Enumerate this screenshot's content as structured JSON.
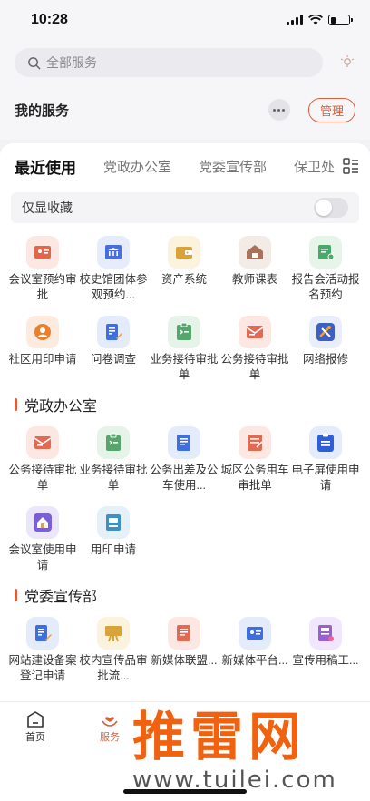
{
  "status": {
    "time": "10:28"
  },
  "search": {
    "placeholder": "全部服务"
  },
  "my_services": {
    "title": "我的服务",
    "manage_label": "管理"
  },
  "tabs": [
    "最近使用",
    "党政办公室",
    "党委宣传部",
    "保卫处"
  ],
  "favorites": {
    "label": "仅显收藏"
  },
  "recent_apps": [
    {
      "label": "会议室预约审批",
      "icon": "id-card-icon",
      "bg": "#fde7e3",
      "fg": "#e4664a"
    },
    {
      "label": "校史馆团体参观预约...",
      "icon": "museum-icon",
      "bg": "#e6ecfb",
      "fg": "#4a6fd8"
    },
    {
      "label": "资产系统",
      "icon": "wallet-icon",
      "bg": "#fbf3dd",
      "fg": "#d8a43a"
    },
    {
      "label": "教师课表",
      "icon": "house-icon",
      "bg": "#f3ebe6",
      "fg": "#a8735a"
    },
    {
      "label": "报告会活动报名预约",
      "icon": "certificate-icon",
      "bg": "#e7f4ea",
      "fg": "#4aa86a"
    },
    {
      "label": "社区用印申请",
      "icon": "user-icon",
      "bg": "#fdebe0",
      "fg": "#e8802e"
    },
    {
      "label": "问卷调查",
      "icon": "document-edit-icon",
      "bg": "#e4ecfb",
      "fg": "#3e6fe0"
    },
    {
      "label": "业务接待审批单",
      "icon": "clipboard-icon",
      "bg": "#e6f3e8",
      "fg": "#57a56c"
    },
    {
      "label": "公务接待审批单",
      "icon": "envelope-icon",
      "bg": "#fde7e3",
      "fg": "#e26a52"
    },
    {
      "label": "网络报修",
      "icon": "tools-icon",
      "bg": "#e9eefb",
      "fg": "#3e5fc4"
    }
  ],
  "section_party_office": {
    "title": "党政办公室",
    "apps": [
      {
        "label": "公务接待审批单",
        "icon": "envelope-icon",
        "bg": "#fde7e3",
        "fg": "#e26a52"
      },
      {
        "label": "业务接待审批单",
        "icon": "clipboard-icon",
        "bg": "#e6f3e8",
        "fg": "#57a56c"
      },
      {
        "label": "公务出差及公车使用...",
        "icon": "document-icon",
        "bg": "#e4ecfb",
        "fg": "#3e6fe0"
      },
      {
        "label": "城区公务用车审批单",
        "icon": "form-icon",
        "bg": "#fde7e3",
        "fg": "#e26a52"
      },
      {
        "label": "电子屏使用申请",
        "icon": "clipboard-list-icon",
        "bg": "#e4ecfb",
        "fg": "#2f5fd6"
      },
      {
        "label": "会议室使用申请",
        "icon": "home-icon",
        "bg": "#ece6fb",
        "fg": "#7a5fd8"
      },
      {
        "label": "用印申请",
        "icon": "stamp-icon",
        "bg": "#e4f1f8",
        "fg": "#3f8fc8"
      }
    ]
  },
  "section_propaganda": {
    "title": "党委宣传部",
    "apps": [
      {
        "label": "网站建设备案登记申请",
        "icon": "document-edit-icon",
        "bg": "#e4ecfb",
        "fg": "#3e6fe0"
      },
      {
        "label": "校内宣传品审批流...",
        "icon": "easel-icon",
        "bg": "#fbf3dd",
        "fg": "#d8a43a"
      },
      {
        "label": "新媒体联盟...",
        "icon": "document-icon",
        "bg": "#fde7e3",
        "fg": "#e26a52"
      },
      {
        "label": "新媒体平台...",
        "icon": "id-card-icon",
        "bg": "#e4ecfb",
        "fg": "#3e6fe0"
      },
      {
        "label": "宣传用稿工...",
        "icon": "newspaper-icon",
        "bg": "#f1e6fb",
        "fg": "#9a5fd0"
      }
    ]
  },
  "bottom_nav": {
    "home": "首页",
    "services": "服务"
  },
  "watermark": {
    "main": "推雷网",
    "url": "www.tuilei.com"
  }
}
